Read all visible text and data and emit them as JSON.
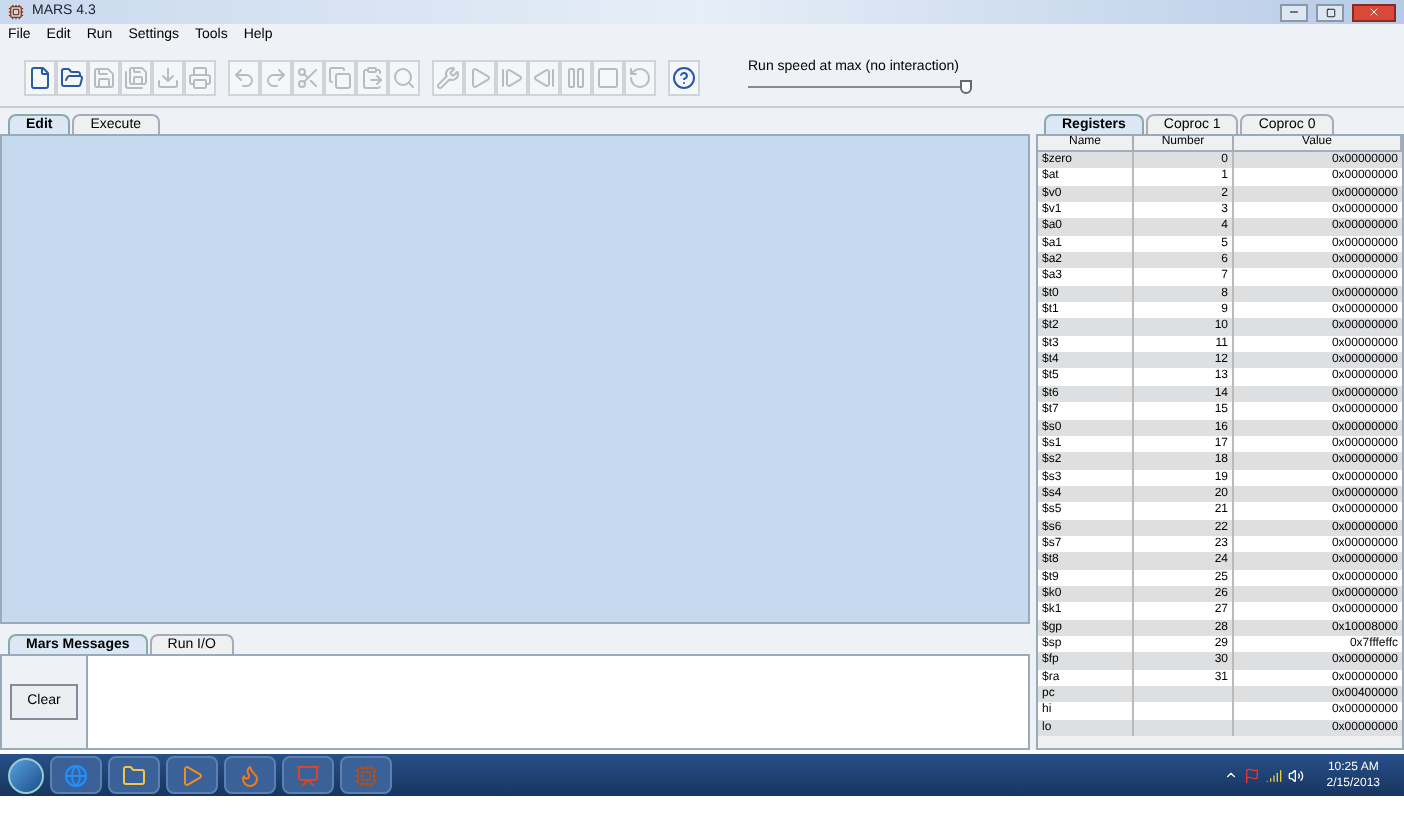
{
  "window": {
    "title": "MARS 4.3"
  },
  "menu": [
    "File",
    "Edit",
    "Run",
    "Settings",
    "Tools",
    "Help"
  ],
  "toolbar": [
    {
      "kind": "new",
      "disabled": false
    },
    {
      "kind": "open",
      "disabled": false
    },
    {
      "kind": "save",
      "disabled": true
    },
    {
      "kind": "saveas",
      "disabled": true
    },
    {
      "kind": "dump",
      "disabled": true
    },
    {
      "kind": "print",
      "disabled": true
    },
    {
      "kind": "undo",
      "disabled": true
    },
    {
      "kind": "redo",
      "disabled": true
    },
    {
      "kind": "cut",
      "disabled": true
    },
    {
      "kind": "copy",
      "disabled": true
    },
    {
      "kind": "paste",
      "disabled": true
    },
    {
      "kind": "find",
      "disabled": true
    },
    {
      "kind": "assemble",
      "disabled": true
    },
    {
      "kind": "go",
      "disabled": true
    },
    {
      "kind": "step",
      "disabled": true
    },
    {
      "kind": "backstep",
      "disabled": true
    },
    {
      "kind": "pause",
      "disabled": true
    },
    {
      "kind": "stop",
      "disabled": true
    },
    {
      "kind": "reset",
      "disabled": true
    },
    {
      "kind": "help",
      "disabled": false
    }
  ],
  "speed": {
    "label": "Run speed at max (no interaction)",
    "level": 1
  },
  "editor_tabs": [
    {
      "label": "Edit",
      "selected": true
    },
    {
      "label": "Execute",
      "selected": false
    }
  ],
  "message_tabs": [
    {
      "label": "Mars Messages",
      "selected": true
    },
    {
      "label": "Run I/O",
      "selected": false
    }
  ],
  "clear_button": "Clear",
  "register_tabs": [
    {
      "label": "Registers",
      "selected": true
    },
    {
      "label": "Coproc 1",
      "selected": false
    },
    {
      "label": "Coproc 0",
      "selected": false
    }
  ],
  "table": {
    "columns": [
      "Name",
      "Number",
      "Value"
    ],
    "rows": [
      [
        "$zero",
        "0",
        "0x00000000"
      ],
      [
        "$at",
        "1",
        "0x00000000"
      ],
      [
        "$v0",
        "2",
        "0x00000000"
      ],
      [
        "$v1",
        "3",
        "0x00000000"
      ],
      [
        "$a0",
        "4",
        "0x00000000"
      ],
      [
        "$a1",
        "5",
        "0x00000000"
      ],
      [
        "$a2",
        "6",
        "0x00000000"
      ],
      [
        "$a3",
        "7",
        "0x00000000"
      ],
      [
        "$t0",
        "8",
        "0x00000000"
      ],
      [
        "$t1",
        "9",
        "0x00000000"
      ],
      [
        "$t2",
        "10",
        "0x00000000"
      ],
      [
        "$t3",
        "11",
        "0x00000000"
      ],
      [
        "$t4",
        "12",
        "0x00000000"
      ],
      [
        "$t5",
        "13",
        "0x00000000"
      ],
      [
        "$t6",
        "14",
        "0x00000000"
      ],
      [
        "$t7",
        "15",
        "0x00000000"
      ],
      [
        "$s0",
        "16",
        "0x00000000"
      ],
      [
        "$s1",
        "17",
        "0x00000000"
      ],
      [
        "$s2",
        "18",
        "0x00000000"
      ],
      [
        "$s3",
        "19",
        "0x00000000"
      ],
      [
        "$s4",
        "20",
        "0x00000000"
      ],
      [
        "$s5",
        "21",
        "0x00000000"
      ],
      [
        "$s6",
        "22",
        "0x00000000"
      ],
      [
        "$s7",
        "23",
        "0x00000000"
      ],
      [
        "$t8",
        "24",
        "0x00000000"
      ],
      [
        "$t9",
        "25",
        "0x00000000"
      ],
      [
        "$k0",
        "26",
        "0x00000000"
      ],
      [
        "$k1",
        "27",
        "0x00000000"
      ],
      [
        "$gp",
        "28",
        "0x10008000"
      ],
      [
        "$sp",
        "29",
        "0x7fffeffc"
      ],
      [
        "$fp",
        "30",
        "0x00000000"
      ],
      [
        "$ra",
        "31",
        "0x00000000"
      ],
      [
        "pc",
        "",
        "0x00400000"
      ],
      [
        "hi",
        "",
        "0x00000000"
      ],
      [
        "lo",
        "",
        "0x00000000"
      ]
    ]
  },
  "taskbar": {
    "apps": [
      {
        "kind": "ie"
      },
      {
        "kind": "explorer"
      },
      {
        "kind": "media"
      },
      {
        "kind": "firefox"
      },
      {
        "kind": "powerpoint"
      },
      {
        "kind": "mars"
      }
    ],
    "time": "10:25 AM",
    "date": "2/15/2013"
  }
}
